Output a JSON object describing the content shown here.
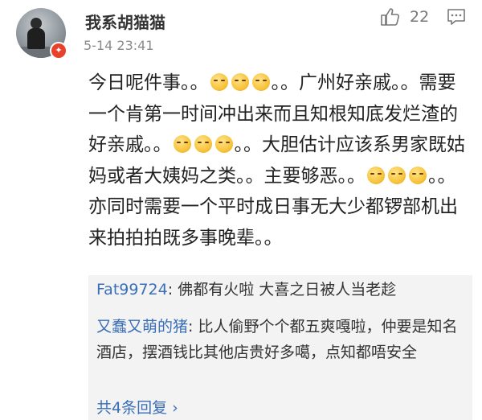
{
  "comment": {
    "username": "我系胡猫猫",
    "timestamp": "5-14 23:41",
    "like_count": "22",
    "badge_icon": "vip-badge-icon",
    "body": {
      "seg1": "今日呢件事。。",
      "seg2": "。。广州好亲戚。。需要一个肯第一时间冲出来而且知根知底发烂渣的好亲戚。。",
      "seg3": "。。大胆估计应该系男家既姑妈或者大姨妈之类。。主要够恶。。",
      "seg4": "。。亦同时需要一个平时成日事无大少都锣部机出来拍拍拍既多事晚辈。。"
    }
  },
  "replies": [
    {
      "name": "Fat99724",
      "text": "佛都有火啦 大喜之日被人当老趁"
    },
    {
      "name": "又蠢又萌的猪",
      "text": "比人偷野个个都五爽嘎啦，仲要是知名酒店，摆酒钱比其他店贵好多噶，点知都唔安全"
    }
  ],
  "more_replies_label": "共4条回复 ›",
  "colors": {
    "link": "#3a6fb7",
    "reply_bg": "#f3f3f3",
    "badge": "#e8402a"
  }
}
